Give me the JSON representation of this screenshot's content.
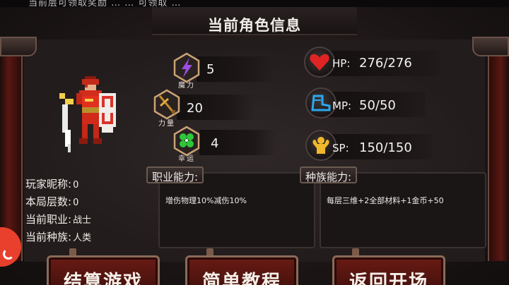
{
  "header": {
    "title": "当前角色信息",
    "top_partial": "当前层可领取奖励  …   …   可领取  …"
  },
  "stats": {
    "magic": {
      "label": "魔力",
      "value": "5",
      "icon": "lightning-icon"
    },
    "strength": {
      "label": "力量",
      "value": "20",
      "icon": "sword-icon"
    },
    "luck": {
      "label": "幸运",
      "value": "4",
      "icon": "clover-icon"
    }
  },
  "resources": {
    "hp": {
      "label": "HP:",
      "value": "276/276",
      "icon": "heart-icon"
    },
    "mp": {
      "label": "MP:",
      "value": "50/50",
      "icon": "boot-icon"
    },
    "sp": {
      "label": "SP:",
      "value": "150/150",
      "icon": "muscle-icon"
    }
  },
  "player": {
    "nickname_label": "玩家昵称:",
    "nickname": "0",
    "floors_label": "本局层数:",
    "floors": "0",
    "job_label": "当前职业:",
    "job": "战士",
    "race_label": "当前种族:",
    "race": "人类"
  },
  "abilities": {
    "job_title": "职业能力:",
    "job_desc": "增伤物理10%减伤10%",
    "race_title": "种族能力:",
    "race_desc": "每层三维+2全部材料+1金币+50"
  },
  "buttons": {
    "settle": "结算游戏",
    "tutorial": "简单教程",
    "back": "返回开场"
  },
  "colors": {
    "frame_red": "#5a1712",
    "button_red": "#6a1a14",
    "float_orange": "#e8402c"
  }
}
